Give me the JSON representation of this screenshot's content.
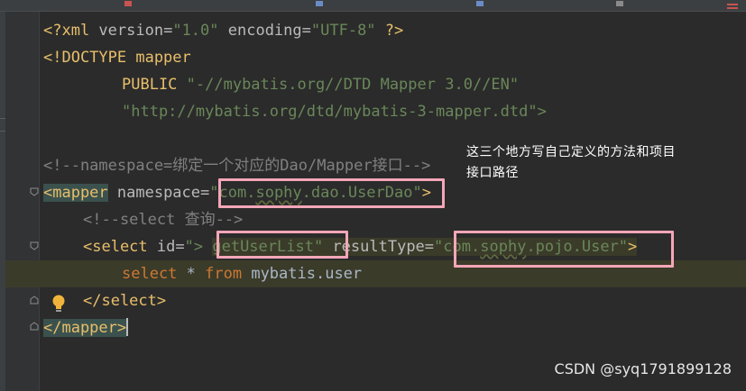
{
  "editor": {
    "lines": {
      "xml_decl": {
        "open": "<?xml ",
        "version_attr": "version",
        "eq1": "=",
        "version_val": "\"1.0\"",
        "encoding_attr": " encoding",
        "eq2": "=",
        "encoding_val": "\"UTF-8\"",
        "close": " ?>"
      },
      "doctype": {
        "text": "<!DOCTYPE mapper"
      },
      "public": {
        "kw": "PUBLIC",
        "val": " \"-//mybatis.org//DTD Mapper 3.0//EN\""
      },
      "dtd": {
        "val": "\"http://mybatis.org/dtd/mybatis-3-mapper.dtd\">"
      },
      "comment1": {
        "text": "<!--namespace=绑定一个对应的Dao/Mapper接口-->"
      },
      "mapper_open": {
        "tag": "<mapper",
        "attr": " namespace",
        "eq": "=",
        "q1": "\"",
        "ns_a": "com.",
        "ns_b": "sophy",
        "ns_c": ".dao.UserDao",
        "q2": "\"",
        "close": ">"
      },
      "comment2": {
        "text": "<!--select 查询-->"
      },
      "select_open": {
        "tag": "<select",
        "attr1": " id",
        "eq1": "=",
        "q1": "\"",
        "sp": "> ",
        "id_val": "getUserList",
        "q2": "\"",
        "attr2": " resultType",
        "eq2": "=",
        "q3": "\"",
        "rt_a": "com.",
        "rt_b": "sophy",
        "rt_c": ".pojo.User",
        "q4": "\"",
        "close": ">"
      },
      "sql": {
        "select_kw": "select",
        "star": " * ",
        "from_kw": "from",
        "table": " mybatis.user"
      },
      "select_close": {
        "tag": "</select>"
      },
      "mapper_close": {
        "tag": "</mapper>"
      }
    },
    "highlight_color": "#3b3b2a"
  },
  "annotation": {
    "line1": "这三个地方写自己定义的方法和项目",
    "line2": "接口路径"
  },
  "watermark": "CSDN @syq1791899128",
  "icons": [
    "fold-marker-icon",
    "lightbulb-icon",
    "window-menu-icon"
  ],
  "colors": {
    "box": "#f4a6b8",
    "tag": "#e8bf6a",
    "string": "#6a8759",
    "keyword": "#cc7832",
    "comment": "#808080"
  }
}
